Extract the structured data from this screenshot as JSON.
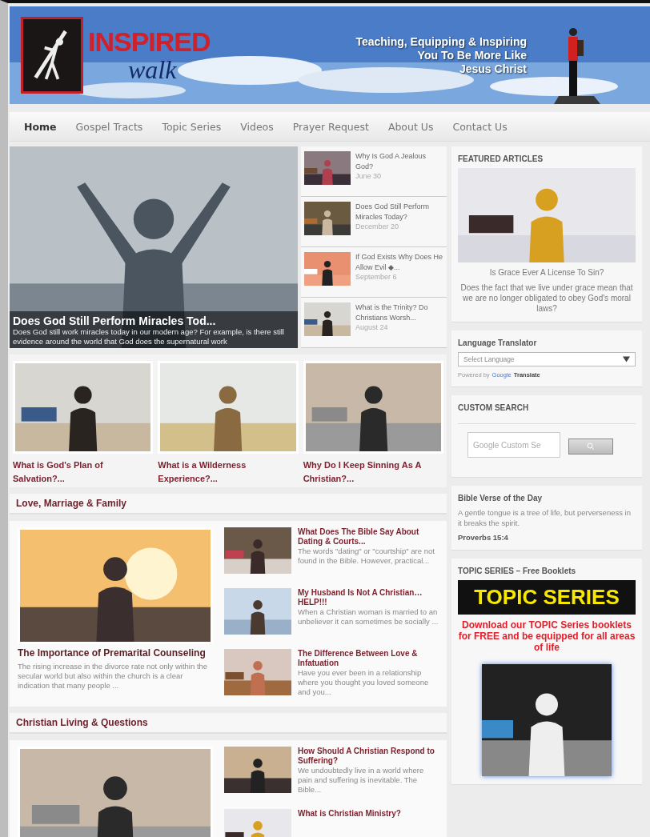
{
  "header": {
    "logo_top": "INSPIRED",
    "logo_bottom": "walk",
    "tagline": [
      "Teaching, Equipping & Inspiring",
      "You To Be More Like",
      "Jesus Christ"
    ]
  },
  "nav": [
    {
      "label": "Home",
      "selected": true
    },
    {
      "label": "Gospel Tracts",
      "selected": false
    },
    {
      "label": "Topic Series",
      "selected": false
    },
    {
      "label": "Videos",
      "selected": false
    },
    {
      "label": "Prayer Request",
      "selected": false
    },
    {
      "label": "About Us",
      "selected": false
    },
    {
      "label": "Contact Us",
      "selected": false
    }
  ],
  "hero": {
    "title": "Does God Still Perform Miracles Tod...",
    "excerpt": "Does God still work miracles today in our modern age? For example, is there still evidence around the world that God does the supernatural work"
  },
  "recent_posts": [
    {
      "title": "Why Is God A Jealous God?",
      "date": "June 30"
    },
    {
      "title": "Does God Still Perform Miracles Today?",
      "date": "December 20"
    },
    {
      "title": "If God Exists Why Does He Allow Evil ◆...",
      "date": "September 6"
    },
    {
      "title": "What is the Trinity? Do Christians Worsh...",
      "date": "August 24"
    }
  ],
  "cards": [
    {
      "title": "What is God's Plan of Salvation?..."
    },
    {
      "title": "What is a Wilderness Experience?..."
    },
    {
      "title": "Why Do I Keep Sinning As A Christian?..."
    }
  ],
  "sections": [
    {
      "heading": "Love, Marriage & Family",
      "lead": {
        "title": "The Importance of Premarital Counseling",
        "excerpt": "The rising increase in the divorce rate not only within the secular world but also within the church is a clear indication that many people ..."
      },
      "posts": [
        {
          "title": "What Does The Bible Say About Dating & Courts...",
          "excerpt": "The words \"dating\" or \"courtship\" are not found in the Bible. However, practical..."
        },
        {
          "title": "My Husband Is Not A Christian… HELP!!!",
          "excerpt": "When a Christian woman is married to an unbeliever it can sometimes be socially ..."
        },
        {
          "title": "The Difference Between Love & Infatuation",
          "excerpt": "Have you ever been in a relationship where you thought you loved someone and you..."
        }
      ]
    },
    {
      "heading": "Christian Living & Questions",
      "posts": [
        {
          "title": "How Should A Christian Respond to Suffering?",
          "excerpt": "We undoubtedly live in a world where pain and suffering is inevitable. The Bible..."
        },
        {
          "title": "What is Christian Ministry?"
        }
      ]
    }
  ],
  "sidebar": {
    "featured": {
      "heading": "FEATURED ARTICLES",
      "title": "Is Grace Ever A License To Sin?",
      "excerpt": "Does the fact that we live under grace mean that we are no longer obligated to obey God's moral laws?"
    },
    "translator": {
      "heading": "Language Translator",
      "select_value": "Select Language",
      "powered_by": "Powered by",
      "google": "Google",
      "translate": "Translate"
    },
    "custom_search": {
      "heading": "CUSTOM SEARCH",
      "placeholder": "Google Custom Se"
    },
    "verse": {
      "heading": "Bible Verse of the Day",
      "text": "A gentle tongue is a tree of life, but perverseness in it breaks the spirit.",
      "reference": "Proverbs 15:4"
    },
    "topic_series": {
      "heading": "TOPIC SERIES – Free Booklets",
      "banner": "TOPIC SERIES",
      "promo": "Download our TOPIC Series booklets for FREE and be equipped for all areas of life"
    }
  }
}
